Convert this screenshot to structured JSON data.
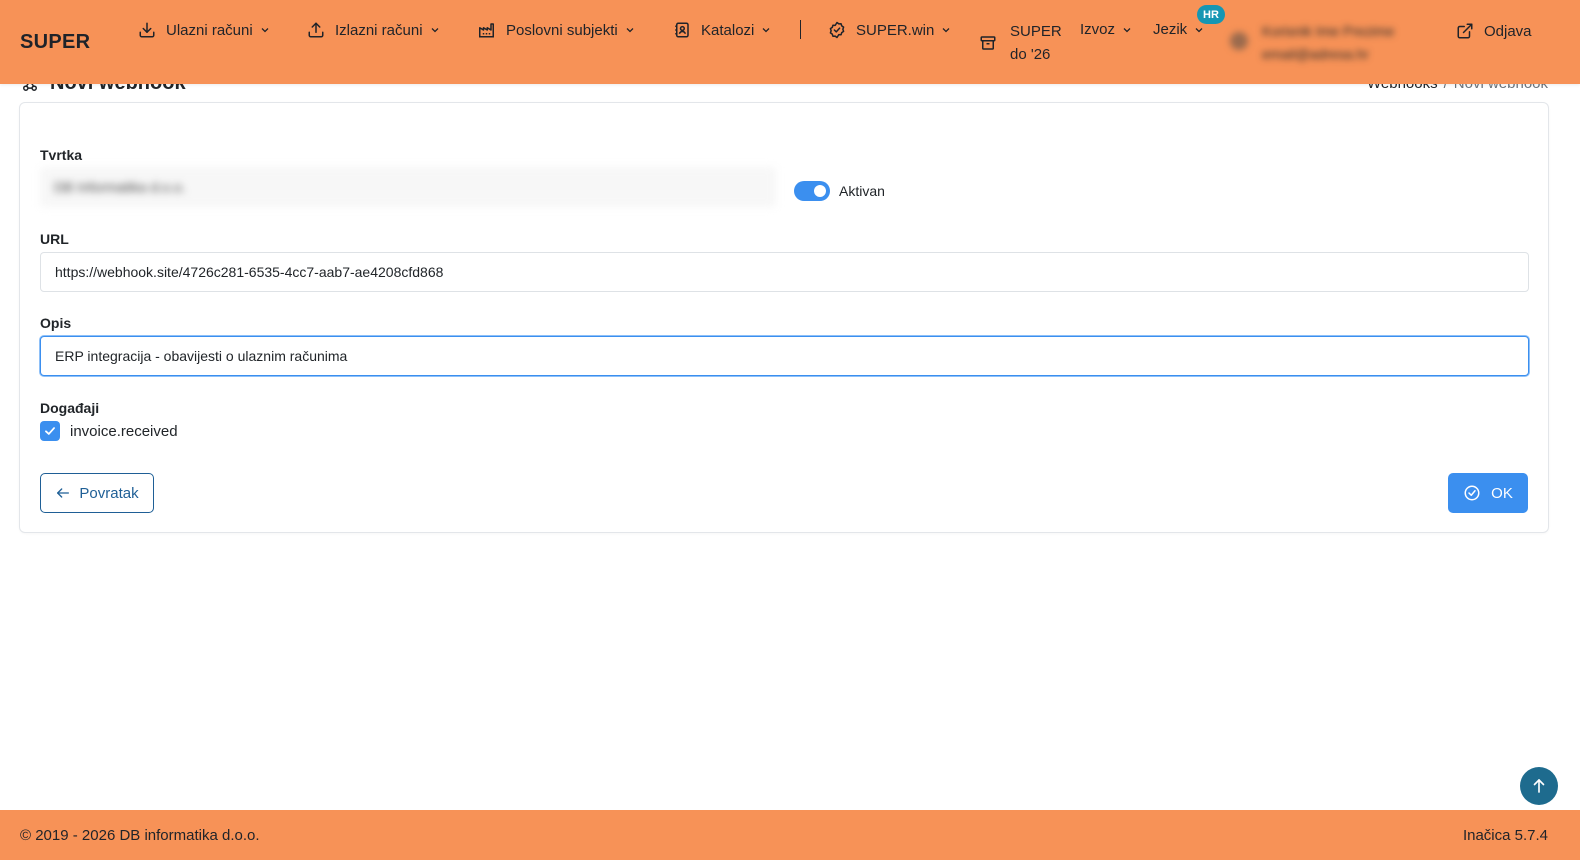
{
  "header": {
    "brand": "SUPER",
    "nav": [
      {
        "label": "Ulazni računi",
        "icon": "download-icon"
      },
      {
        "label": "Izlazni računi",
        "icon": "upload-icon"
      },
      {
        "label": "Poslovni subjekti",
        "icon": "factory-icon"
      },
      {
        "label": "Katalozi",
        "icon": "contacts-book-icon"
      },
      {
        "label": "SUPER.win",
        "icon": "badge-check-icon"
      }
    ],
    "super_do": {
      "line1": "SUPER",
      "line2": "do '26",
      "icon": "archive-box-icon"
    },
    "export_label": "Izvoz",
    "language_label": "Jezik",
    "language_badge": "HR",
    "user": {
      "name": "Korisnik Ime Prezime",
      "email": "email@adresa.hr"
    },
    "logout_label": "Odjava"
  },
  "page": {
    "title": "Novi webhook",
    "breadcrumb": [
      "Webhooks",
      "Novi webhook"
    ]
  },
  "form": {
    "company_label": "Tvrtka",
    "company_value": "DB Informatika d.o.o.",
    "active_label": "Aktivan",
    "active": true,
    "url_label": "URL",
    "url_value": "https://webhook.site/4726c281-6535-4cc7-aab7-ae4208cfd868",
    "description_label": "Opis",
    "description_value": "ERP integracija - obavijesti o ulaznim računima",
    "events_label": "Događaji",
    "events": [
      {
        "name": "invoice.received",
        "checked": true
      }
    ],
    "back_label": "Povratak",
    "ok_label": "OK"
  },
  "footer": {
    "copyright": "© 2019 - 2026 DB informatika d.o.o.",
    "version": "Inačica 5.7.4"
  },
  "colors": {
    "header_bg": "#f79257",
    "primary": "#3b8fef",
    "back_button": "#1f5f96",
    "scroll_top": "#1e6b8e",
    "badge": "#1596b3"
  }
}
